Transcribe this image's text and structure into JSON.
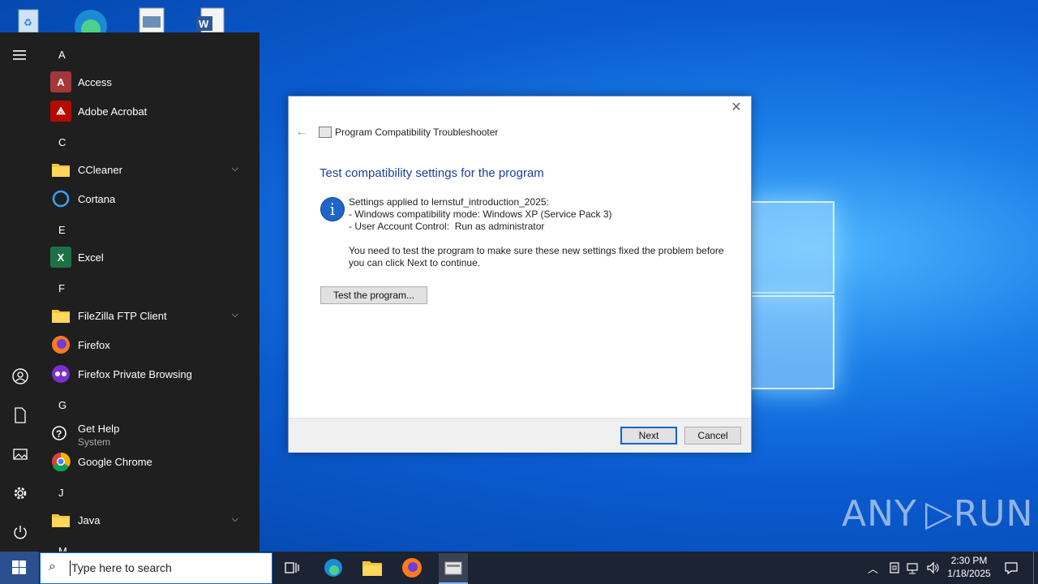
{
  "start_menu": {
    "letters": [
      "A",
      "C",
      "E",
      "F",
      "G",
      "J",
      "M"
    ],
    "apps": [
      {
        "label": "Access",
        "icon": "access-icon"
      },
      {
        "label": "Adobe Acrobat",
        "icon": "acrobat-icon"
      },
      {
        "label": "CCleaner",
        "icon": "folder-icon",
        "expandable": true
      },
      {
        "label": "Cortana",
        "icon": "cortana-icon"
      },
      {
        "label": "Excel",
        "icon": "excel-icon"
      },
      {
        "label": "FileZilla FTP Client",
        "icon": "folder-icon",
        "expandable": true
      },
      {
        "label": "Firefox",
        "icon": "firefox-icon"
      },
      {
        "label": "Firefox Private Browsing",
        "icon": "firefox-private-icon"
      },
      {
        "label": "Get Help",
        "sublabel": "System",
        "icon": "get-help-icon"
      },
      {
        "label": "Google Chrome",
        "icon": "chrome-icon"
      },
      {
        "label": "Java",
        "icon": "folder-icon",
        "expandable": true
      }
    ]
  },
  "dialog": {
    "window_title": "Program Compatibility Troubleshooter",
    "heading": "Test compatibility settings for the program",
    "settings_lines": [
      "Settings applied to lernstuf_introduction_2025:",
      "- Windows compatibility mode: Windows XP (Service Pack 3)",
      "- User Account Control:  Run as administrator"
    ],
    "instruction": "You need to test the program to make sure these new settings fixed the problem before you can click Next to continue.",
    "test_button": "Test the program...",
    "next_button": "Next",
    "cancel_button": "Cancel"
  },
  "taskbar": {
    "search_placeholder": "Type here to search",
    "time": "2:30 PM",
    "date": "1/18/2025"
  },
  "watermark": "ANY RUN"
}
